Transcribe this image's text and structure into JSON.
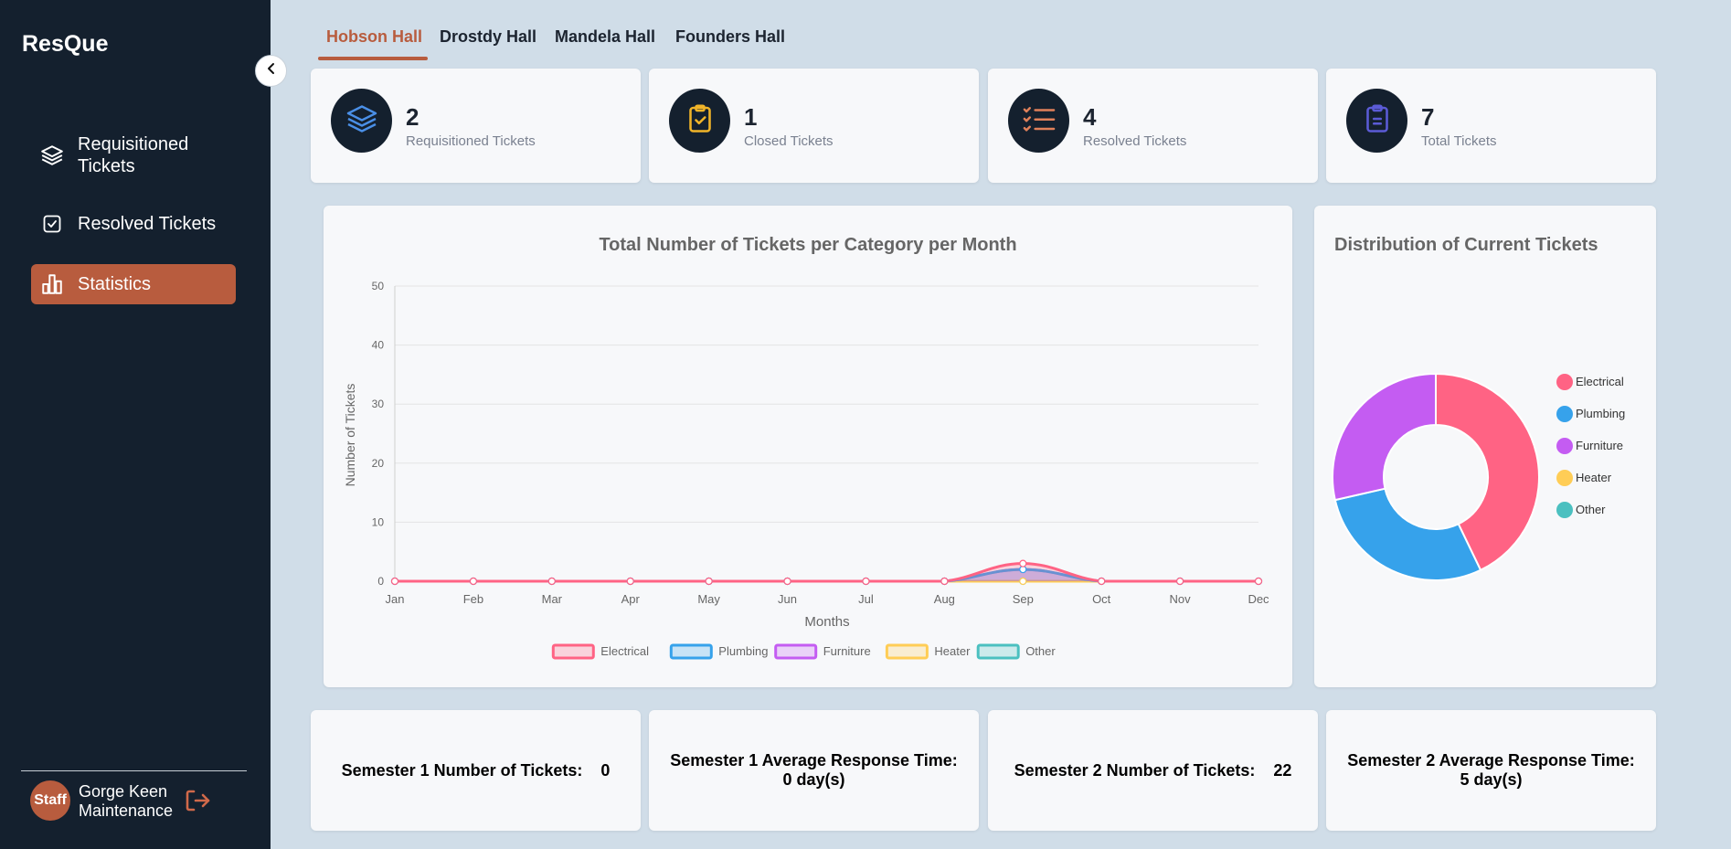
{
  "app": {
    "brand": "ResQue"
  },
  "sidebar": {
    "items": [
      {
        "label": "Requisitioned Tickets",
        "icon": "layers-icon"
      },
      {
        "label": "Resolved Tickets",
        "icon": "check-square-icon"
      },
      {
        "label": "Statistics",
        "icon": "bar-chart-icon",
        "active": true
      }
    ],
    "user": {
      "avatar_text": "Staff",
      "name": "Gorge Keen",
      "role": "Maintenance"
    }
  },
  "tabs": [
    {
      "label": "Hobson Hall",
      "active": true
    },
    {
      "label": "Drostdy Hall"
    },
    {
      "label": "Mandela Hall"
    },
    {
      "label": "Founders Hall"
    }
  ],
  "stats": [
    {
      "value": "2",
      "label": "Requisitioned Tickets",
      "icon": "layers-icon",
      "color": "#4a8fe7"
    },
    {
      "value": "1",
      "label": "Closed Tickets",
      "icon": "clipboard-check-icon",
      "color": "#f0b429"
    },
    {
      "value": "4",
      "label": "Resolved Tickets",
      "icon": "checklist-icon",
      "color": "#e0805a"
    },
    {
      "value": "7",
      "label": "Total Tickets",
      "icon": "clipboard-icon",
      "color": "#5b5bd6"
    }
  ],
  "bottom": [
    {
      "label": "Semester 1 Number of Tickets:",
      "value": "0"
    },
    {
      "label": "Semester 1 Average Response Time:",
      "value": "0 day(s)"
    },
    {
      "label": "Semester 2 Number of Tickets:",
      "value": "22"
    },
    {
      "label": "Semester 2 Average Response Time:",
      "value": "5 day(s)"
    }
  ],
  "chart_data": [
    {
      "type": "area",
      "title": "Total Number of Tickets per Category per Month",
      "xlabel": "Months",
      "ylabel": "Number of Tickets",
      "categories": [
        "Jan",
        "Feb",
        "Mar",
        "Apr",
        "May",
        "Jun",
        "Jul",
        "Aug",
        "Sep",
        "Oct",
        "Nov",
        "Dec"
      ],
      "ylim": [
        0,
        50
      ],
      "yticks": [
        0,
        10,
        20,
        30,
        40,
        50
      ],
      "grid": true,
      "legend": "bottom",
      "series": [
        {
          "name": "Electrical",
          "color": "#ff6384",
          "values": [
            0,
            0,
            0,
            0,
            0,
            0,
            0,
            0,
            3,
            0,
            0,
            0
          ]
        },
        {
          "name": "Plumbing",
          "color": "#36a2eb",
          "values": [
            0,
            0,
            0,
            0,
            0,
            0,
            0,
            0,
            2,
            0,
            0,
            0
          ]
        },
        {
          "name": "Furniture",
          "color": "#c45cf2",
          "values": [
            0,
            0,
            0,
            0,
            0,
            0,
            0,
            0,
            2,
            0,
            0,
            0
          ]
        },
        {
          "name": "Heater",
          "color": "#ffcd56",
          "values": [
            0,
            0,
            0,
            0,
            0,
            0,
            0,
            0,
            0,
            0,
            0,
            0
          ]
        },
        {
          "name": "Other",
          "color": "#4bc0c0",
          "values": [
            0,
            0,
            0,
            0,
            0,
            0,
            0,
            0,
            0,
            0,
            0,
            0
          ]
        }
      ]
    },
    {
      "type": "pie",
      "title": "Distribution of Current Tickets",
      "legend": "right",
      "labels": [
        "Electrical",
        "Plumbing",
        "Furniture",
        "Heater",
        "Other"
      ],
      "colors": [
        "#ff6384",
        "#36a2eb",
        "#c45cf2",
        "#ffcd56",
        "#4bc0c0"
      ],
      "values": [
        3,
        2,
        2,
        0,
        0
      ]
    }
  ]
}
